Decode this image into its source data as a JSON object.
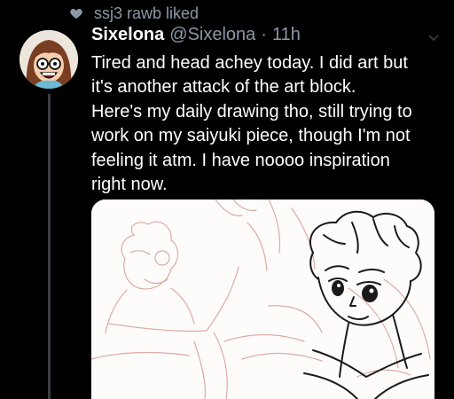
{
  "social_context": {
    "icon": "heart-icon",
    "text": "ssj3 rawb liked"
  },
  "tweet": {
    "display_name": "Sixelona",
    "handle": "@Sixelona",
    "separator": "·",
    "timestamp": "11h",
    "text": "Tired and head achey today. I did art but\nit's another attack of the art block.\nHere's my daily drawing tho, still trying to\nwork on my saiyuki piece, though I'm not\nfeeling it atm. I have noooo inspiration\nright now."
  },
  "media": {
    "type": "sketch-image",
    "description_icon": "drawing-image"
  },
  "colors": {
    "background": "#000000",
    "text_primary": "#ffffff",
    "text_secondary": "#8b98a5",
    "thread_line": "#3a3f44",
    "sketch_red": "#dcaaa6"
  }
}
